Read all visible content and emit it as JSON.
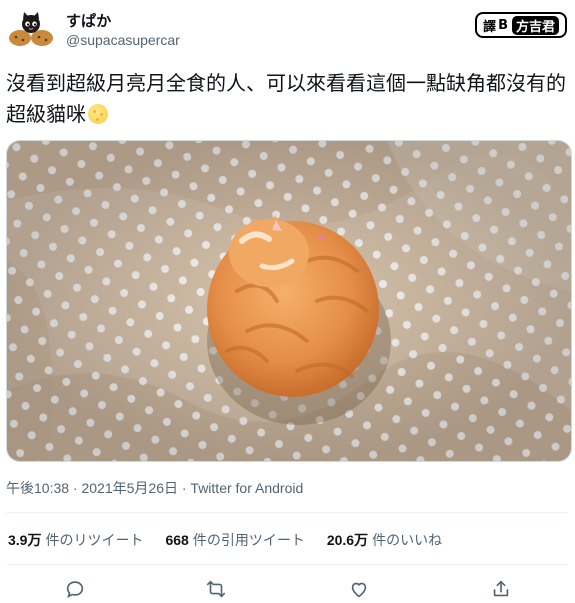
{
  "user": {
    "display_name": "すぱか",
    "handle": "@supacasupercar"
  },
  "watermark": {
    "prefix": "譯",
    "separator": "B",
    "name": "方吉君"
  },
  "tweet": {
    "text": "沒看到超級月亮月全食的人、可以來看看這個一點缺角都沒有的超級貓咪",
    "emoji_icon": "full-moon-icon",
    "image_subject": "orange cat curled into a ball on a polka-dot blanket"
  },
  "meta": {
    "timestamp": "午後10:38 · 2021年5月26日 · Twitter for Android"
  },
  "stats": [
    {
      "value": "3.9万",
      "label": "件のリツイート"
    },
    {
      "value": "668",
      "label": "件の引用ツイート"
    },
    {
      "value": "20.6万",
      "label": "件のいいね"
    }
  ],
  "actions": [
    {
      "icon": "reply-icon"
    },
    {
      "icon": "retweet-icon"
    },
    {
      "icon": "like-icon"
    },
    {
      "icon": "share-icon"
    }
  ],
  "colors": {
    "text_primary": "#0f1419",
    "text_secondary": "#536471",
    "blanket": "#d8c4ad",
    "cat": "#e4934e"
  }
}
